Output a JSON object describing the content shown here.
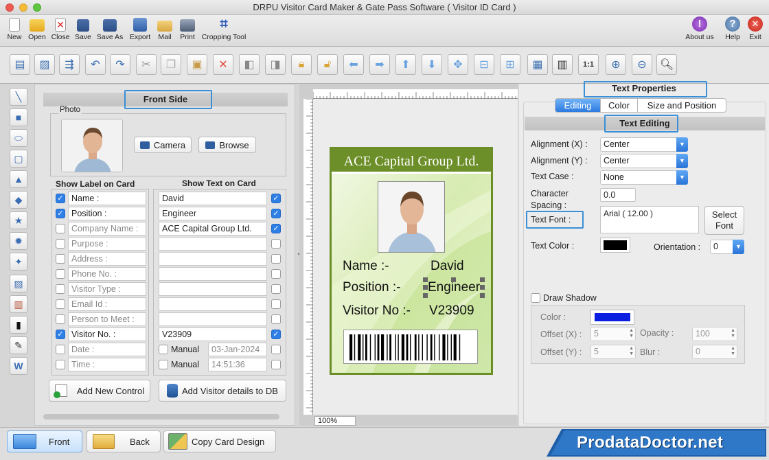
{
  "window": {
    "title": "DRPU Visitor Card Maker & Gate Pass Software ( Visitor ID Card )"
  },
  "toolbar": {
    "new": "New",
    "open": "Open",
    "close": "Close",
    "save": "Save",
    "save_as": "Save As",
    "export": "Export",
    "mail": "Mail",
    "print": "Print",
    "cropping_tool": "Cropping Tool",
    "about_us": "About us",
    "help": "Help",
    "exit": "Exit"
  },
  "front_side": {
    "title": "Front Side",
    "photo_label": "Photo",
    "camera_label": "Camera",
    "browse_label": "Browse",
    "show_label_header": "Show Label on Card",
    "show_text_header": "Show Text on Card",
    "rows": [
      {
        "label": "Name :",
        "label_checked": true,
        "text": "David",
        "text_checked": true
      },
      {
        "label": "Position :",
        "label_checked": true,
        "text": "Engineer",
        "text_checked": true
      },
      {
        "label": "Company Name :",
        "label_checked": false,
        "text": "ACE Capital Group Ltd.",
        "text_checked": true
      },
      {
        "label": "Purpose :",
        "label_checked": false,
        "text": "",
        "text_checked": false
      },
      {
        "label": "Address :",
        "label_checked": false,
        "text": "",
        "text_checked": false
      },
      {
        "label": "Phone No. :",
        "label_checked": false,
        "text": "",
        "text_checked": false
      },
      {
        "label": "Visitor Type :",
        "label_checked": false,
        "text": "",
        "text_checked": false
      },
      {
        "label": "Email Id :",
        "label_checked": false,
        "text": "",
        "text_checked": false
      },
      {
        "label": "Person to Meet :",
        "label_checked": false,
        "text": "",
        "text_checked": false
      },
      {
        "label": "Visitor No. :",
        "label_checked": true,
        "text": "V23909",
        "text_checked": true
      },
      {
        "label": "Date :",
        "label_checked": false,
        "manual": "Manual",
        "text": "03-Jan-2024",
        "text_checked": false
      },
      {
        "label": "Time :",
        "label_checked": false,
        "manual": "Manual",
        "text": "14:51:36",
        "text_checked": false
      }
    ],
    "add_control_label": "Add New Control",
    "add_db_label": "Add Visitor details to DB"
  },
  "card": {
    "company": "ACE Capital Group Ltd.",
    "name_label": "Name :-",
    "name_value": "David",
    "position_label": "Position :-",
    "position_value": "Engineer",
    "visitor_label": "Visitor No :-",
    "visitor_value": "V23909",
    "zoom": "100%",
    "header_color": "#6d8f2a",
    "border_color": "#6c8e27"
  },
  "text_properties": {
    "title": "Text Properties",
    "tabs": [
      "Editing",
      "Color",
      "Size and Position"
    ],
    "active_tab": "Editing",
    "section_title": "Text Editing",
    "alignment_x_label": "Alignment (X) :",
    "alignment_x": "Center",
    "alignment_y_label": "Alignment (Y) :",
    "alignment_y": "Center",
    "text_case_label": "Text Case :",
    "text_case": "None",
    "char_spacing_label_1": "Character",
    "char_spacing_label_2": "Spacing :",
    "char_spacing": "0.0",
    "text_font_label": "Text Font :",
    "text_font": "Arial ( 12.00 )",
    "select_font_1": "Select",
    "select_font_2": "Font",
    "text_color_label": "Text Color :",
    "text_color": "#000000",
    "orientation_label": "Orientation :",
    "orientation": "0",
    "draw_shadow_label": "Draw Shadow",
    "shadow_color_label": "Color :",
    "shadow_color": "#0a1fe0",
    "offset_x_label": "Offset (X) :",
    "offset_x": "5",
    "offset_y_label": "Offset (Y) :",
    "offset_y": "5",
    "opacity_label": "Opacity :",
    "opacity": "100",
    "blur_label": "Blur :",
    "blur": "0"
  },
  "bottom": {
    "front_label": "Front",
    "back_label": "Back",
    "copy_label": "Copy Card Design",
    "brand": "ProdataDoctor.net"
  }
}
